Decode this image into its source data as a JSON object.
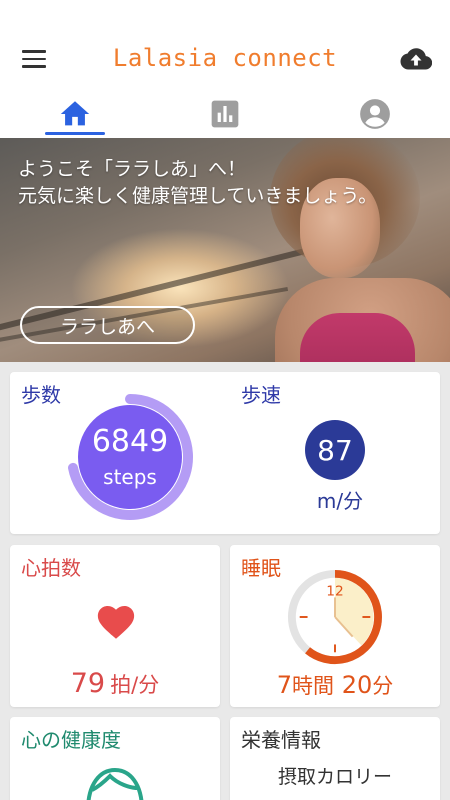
{
  "app": {
    "title": "Lalasia connect"
  },
  "tabs": [
    {
      "name": "home",
      "icon": "home-icon",
      "active": true
    },
    {
      "name": "chart",
      "icon": "bar-chart-icon",
      "active": false
    },
    {
      "name": "profile",
      "icon": "account-icon",
      "active": false
    }
  ],
  "hero": {
    "message": "ようこそ「ララしあ」へ！\n元気に楽しく健康管理していきましょう。",
    "button_label": "ララしあへ"
  },
  "cards": {
    "steps": {
      "title": "歩数",
      "value": "6849",
      "unit": "steps",
      "progress": 0.72,
      "color": "#2f3aa8"
    },
    "speed": {
      "title": "歩速",
      "value": "87",
      "unit": "m/分",
      "color": "#2b3a97"
    },
    "heart": {
      "title": "心拍数",
      "value": "79",
      "unit": "拍/分",
      "color": "#d94a4a"
    },
    "sleep": {
      "title": "睡眠",
      "clock_label": "12",
      "hours": "7",
      "hours_unit": "時間",
      "minutes": "20",
      "minutes_unit": "分",
      "color": "#e0541a"
    },
    "mental": {
      "title": "心の健康度",
      "color": "#1f8a6e"
    },
    "nutrition": {
      "title": "栄養情報",
      "subtitle": "摂取カロリー",
      "color": "#333333"
    }
  },
  "colors": {
    "accent": "#f07d2e",
    "tab_active": "#2b62e0",
    "tab_inactive": "#9e9e9e"
  }
}
